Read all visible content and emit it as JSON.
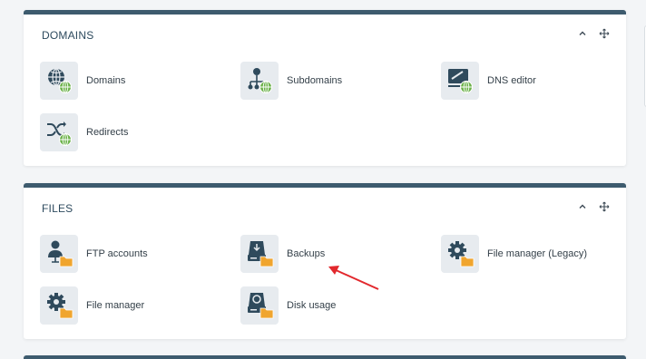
{
  "panels": {
    "domains": {
      "title": "DOMAINS",
      "items": [
        {
          "label": "Domains",
          "icon": "globe-icon"
        },
        {
          "label": "Subdomains",
          "icon": "sitemap-icon"
        },
        {
          "label": "DNS editor",
          "icon": "dns-editor-icon"
        },
        {
          "label": "Redirects",
          "icon": "shuffle-icon"
        }
      ]
    },
    "files": {
      "title": "FILES",
      "items": [
        {
          "label": "FTP accounts",
          "icon": "ftp-user-icon"
        },
        {
          "label": "Backups",
          "icon": "backup-drive-icon"
        },
        {
          "label": "File manager (Legacy)",
          "icon": "gear-folder-icon"
        },
        {
          "label": "File manager",
          "icon": "gear-folder-icon"
        },
        {
          "label": "Disk usage",
          "icon": "disk-usage-icon"
        }
      ]
    }
  },
  "colors": {
    "panel_header": "#3d5b6e",
    "icon_dark": "#2f4a5c",
    "globe_green": "#6cb24a",
    "folder_orange": "#f0a52e",
    "annotation_red": "#e2282d"
  }
}
